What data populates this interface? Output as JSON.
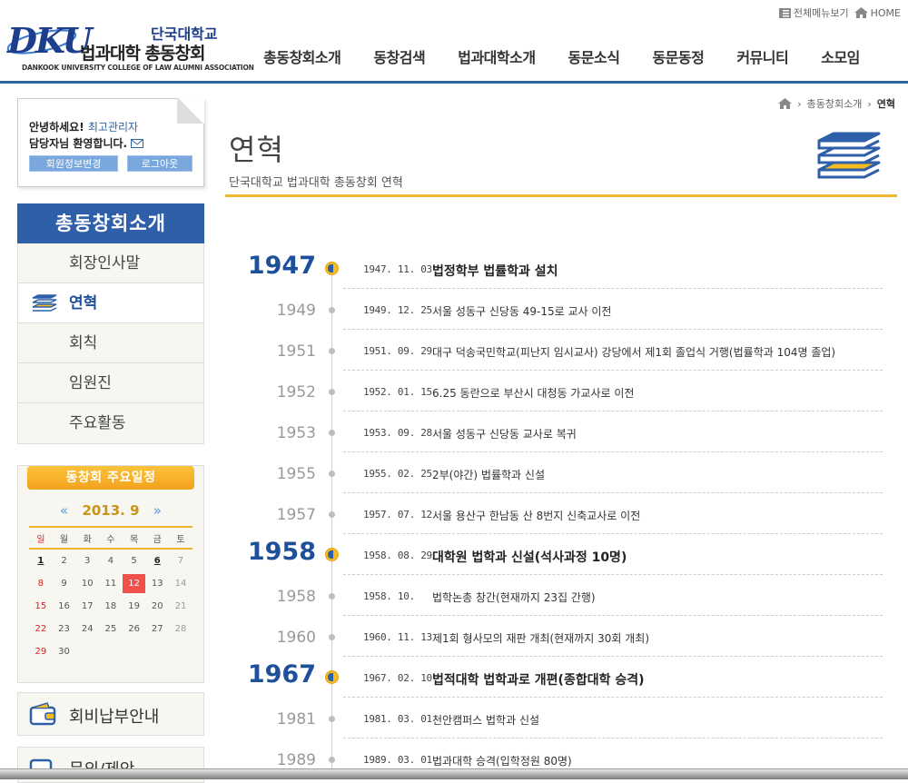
{
  "header": {
    "logo_dku": "DKU",
    "logo_top": "단국대학교",
    "logo_main": "법과대학 총동창회",
    "logo_sub": "DANKOOK UNIVERSITY COLLEGE OF LAW ALUMNI ASSOCIATION",
    "util_sitemap": "전체메뉴보기",
    "util_home": "HOME",
    "gnb": [
      "총동창회소개",
      "동창검색",
      "법과대학소개",
      "동문소식",
      "동문동정",
      "커뮤니티",
      "소모임"
    ]
  },
  "login": {
    "greeting": "안녕하세요!",
    "user": "최고관리자",
    "welcome": "담당자님 환영합니다.",
    "edit_button": "회원정보변경",
    "logout_button": "로그아웃"
  },
  "snb": {
    "title": "총동창회소개",
    "items": [
      "회장인사말",
      "연혁",
      "회칙",
      "임원진",
      "주요활동"
    ]
  },
  "calendar": {
    "title": "동창회 주요일정",
    "prev": "«",
    "month": "2013. 9",
    "next": "»",
    "weekdays": [
      "일",
      "월",
      "화",
      "수",
      "목",
      "금",
      "토"
    ],
    "weeks": [
      [
        "1",
        "2",
        "3",
        "4",
        "5",
        "6",
        "7"
      ],
      [
        "8",
        "9",
        "10",
        "11",
        "12",
        "13",
        "14"
      ],
      [
        "15",
        "16",
        "17",
        "18",
        "19",
        "20",
        "21"
      ],
      [
        "22",
        "23",
        "24",
        "25",
        "26",
        "27",
        "28"
      ],
      [
        "29",
        "30",
        "",
        "",
        "",
        "",
        ""
      ]
    ],
    "today": "12",
    "event_days": [
      "1",
      "6"
    ]
  },
  "side_links": {
    "fee": "회비납부안내",
    "inquiry": "문의/제안"
  },
  "breadcrumb": {
    "section": "총동창회소개",
    "current": "연혁"
  },
  "page": {
    "title": "연혁",
    "subtitle": "단국대학교 법과대학 총동창회 연혁"
  },
  "timeline": [
    {
      "year": "1947",
      "major": true,
      "date": "1947. 11. 03",
      "text": "법정학부 법률학과 설치"
    },
    {
      "year": "1949",
      "major": false,
      "date": "1949. 12. 25",
      "text": "서울 성동구 신당동 49-15로 교사 이전"
    },
    {
      "year": "1951",
      "major": false,
      "date": "1951. 09. 29",
      "text": "대구 덕송국민학교(피난지 임시교사) 강당에서 제1회 졸업식 거행(법률학과 104명 졸업)"
    },
    {
      "year": "1952",
      "major": false,
      "date": "1952. 01. 15",
      "text": "6.25 동란으로 부산시 대청동 가교사로 이전"
    },
    {
      "year": "1953",
      "major": false,
      "date": "1953. 09. 28",
      "text": "서울 성동구 신당동 교사로 복귀"
    },
    {
      "year": "1955",
      "major": false,
      "date": "1955. 02. 25",
      "text": "2부(야간) 법률학과 신설"
    },
    {
      "year": "1957",
      "major": false,
      "date": "1957. 07. 12",
      "text": "서울 용산구 한남동 산 8번지 신축교사로 이전"
    },
    {
      "year": "1958",
      "major": true,
      "date": "1958. 08. 29",
      "text": "대학원 법학과 신설(석사과정 10명)"
    },
    {
      "year": "1958",
      "major": false,
      "date": "1958. 10.",
      "text": "법학논총 창간(현재까지 23집 간행)"
    },
    {
      "year": "1960",
      "major": false,
      "date": "1960. 11. 13",
      "text": "제1회 형사모의 재판 개최(현재까지 30회 개최)"
    },
    {
      "year": "1967",
      "major": true,
      "date": "1967. 02. 10",
      "text": "법적대학 법학과로 개편(종합대학 승격)"
    },
    {
      "year": "1981",
      "major": false,
      "date": "1981. 03. 01",
      "text": "천안캠퍼스 법학과 신설"
    },
    {
      "year": "1989",
      "major": false,
      "date": "1989. 03. 01",
      "text": "법과대학 승격(입학정원 80명)"
    }
  ],
  "colors": {
    "brand_blue": "#2e5fa8",
    "accent_yellow": "#f6bb21",
    "today_red": "#f0504a"
  }
}
